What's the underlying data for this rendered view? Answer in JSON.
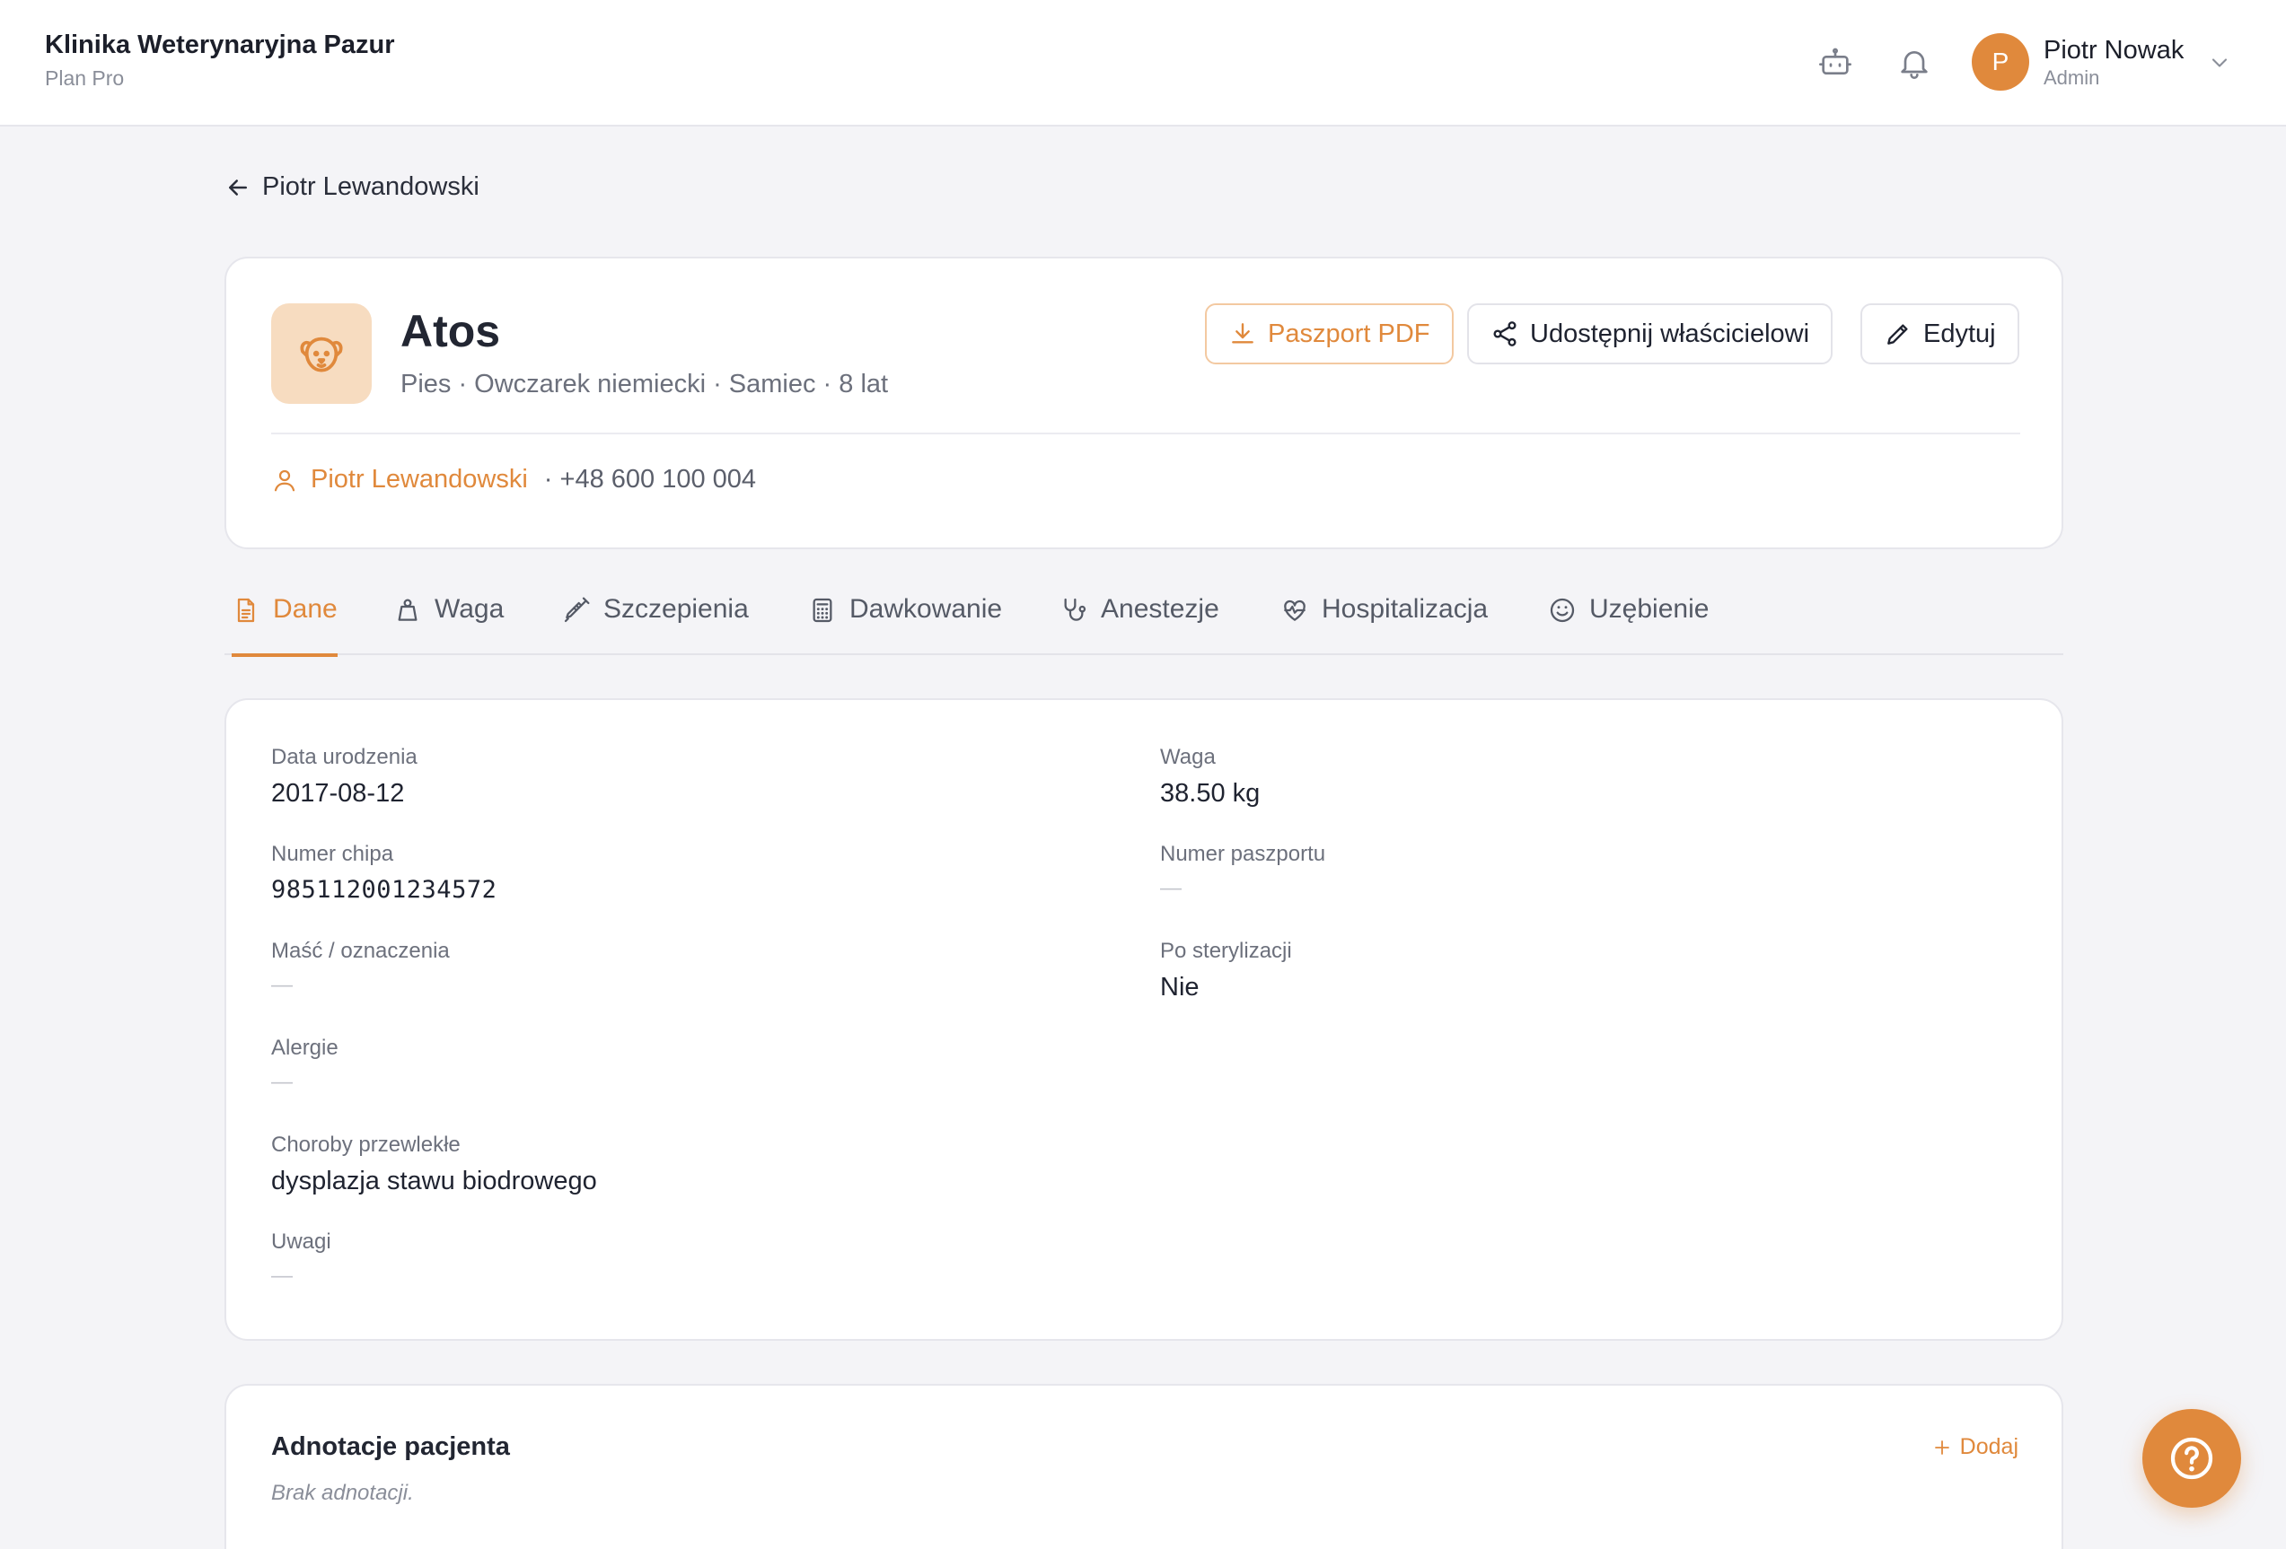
{
  "header": {
    "clinic_name": "Klinika Weterynaryjna Pazur",
    "plan": "Plan Pro",
    "user": {
      "initial": "P",
      "name": "Piotr Nowak",
      "role": "Admin"
    },
    "icons": [
      "robot-icon",
      "bell-icon",
      "chevron-down-icon"
    ]
  },
  "back_link": {
    "label": "Piotr Lewandowski"
  },
  "patient": {
    "name": "Atos",
    "meta": "Pies · Owczarek niemiecki · Samiec · 8 lat",
    "owner_name": "Piotr Lewandowski",
    "owner_phone": "· +48 600 100 004",
    "actions": {
      "pdf": "Paszport PDF",
      "share": "Udostępnij właścicielowi",
      "edit": "Edytuj"
    }
  },
  "tabs": [
    {
      "label": "Dane",
      "icon": "document-icon",
      "active": true
    },
    {
      "label": "Waga",
      "icon": "weight-icon",
      "active": false
    },
    {
      "label": "Szczepienia",
      "icon": "syringe-icon",
      "active": false
    },
    {
      "label": "Dawkowanie",
      "icon": "calculator-icon",
      "active": false
    },
    {
      "label": "Anestezje",
      "icon": "stethoscope-icon",
      "active": false
    },
    {
      "label": "Hospitalizacja",
      "icon": "heart-pulse-icon",
      "active": false
    },
    {
      "label": "Uzębienie",
      "icon": "smile-icon",
      "active": false
    }
  ],
  "details": {
    "birth_date": {
      "label": "Data urodzenia",
      "value": "2017-08-12"
    },
    "weight": {
      "label": "Waga",
      "value": "38.50 kg"
    },
    "chip_number": {
      "label": "Numer chipa",
      "value": "985112001234572"
    },
    "passport_number": {
      "label": "Numer paszportu",
      "value": "—"
    },
    "coat": {
      "label": "Maść / oznaczenia",
      "value": "—"
    },
    "sterilized": {
      "label": "Po sterylizacji",
      "value": "Nie"
    },
    "allergies": {
      "label": "Alergie",
      "value": "—"
    },
    "chronic": {
      "label": "Choroby przewlekłe",
      "value": "dysplazja stawu biodrowego"
    },
    "notes": {
      "label": "Uwagi",
      "value": "—"
    }
  },
  "annotations": {
    "title": "Adnotacje pacjenta",
    "empty": "Brak adnotacji.",
    "add_label": "Dodaj"
  },
  "colors": {
    "accent": "#e0893c",
    "accent_light": "#f7dcc0",
    "background": "#f4f4f7"
  }
}
